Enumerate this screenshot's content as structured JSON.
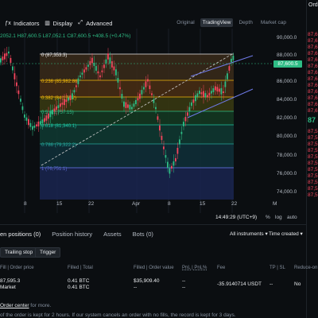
{
  "toolbar": {
    "indicators": "Indicators",
    "display": "Display",
    "advanced": "Advanced",
    "views": [
      "Original",
      "TradingView",
      "Depth",
      "Market cap"
    ]
  },
  "chart": {
    "ohlc_text": "2052.1 H87,600.5 L87,052.1 C87,600.5 +408.5 (+0.47%)",
    "y_labels": [
      "90,000.0",
      "88,000.0",
      "86,000.0",
      "84,000.0",
      "82,000.0",
      "80,000.0",
      "78,000.0",
      "76,000.0",
      "74,000.0"
    ],
    "last_price_tag": "87,600.5",
    "fib_levels": [
      {
        "label": "0 (87,353.3)",
        "color": "#f0f0f0"
      },
      {
        "label": "0.236 (85,982.86)",
        "color": "#f6465d"
      },
      {
        "label": "0.382 (84,174.2)",
        "color": "#f0b90b"
      },
      {
        "label": "0.5 (82,757.15)",
        "color": "#2ebd85"
      },
      {
        "label": "0.618 (81,340.1)",
        "color": "#1ec8a5"
      },
      {
        "label": "0.786 (79,322.2)",
        "color": "#26a69a"
      },
      {
        "label": "1 (76,751.1)",
        "color": "#5a6ad0"
      }
    ],
    "x_labels": [
      "8",
      "15",
      "22",
      "Apr",
      "8",
      "15",
      "22",
      "M"
    ],
    "time_readout": "14:49:29 (UTC+9)",
    "scale_options": [
      "%",
      "log",
      "auto"
    ],
    "colors": {
      "up": "#2ebd85",
      "down": "#f6465d",
      "accent": "#f0b90b"
    }
  },
  "orderbook": {
    "title": "Ord",
    "rows": [
      "87,6",
      "87,6",
      "87,6",
      "87,6",
      "87,6",
      "87,6",
      "87,6",
      "87,6",
      "87,6",
      "87,6",
      "87,6",
      "87,6",
      "87,6"
    ],
    "big_price": "87",
    "rows2": [
      "87,5",
      "87,5",
      "87,5",
      "87,5",
      "87,5",
      "87,5",
      "87,5",
      "87,5",
      "87,5",
      "87,5",
      "87,5"
    ]
  },
  "positions": {
    "tabs": [
      "en positions (0)",
      "Position history",
      "Assets",
      "Bots (0)"
    ],
    "filter_instruments": "All instruments",
    "filter_time": "Time created",
    "pills": [
      "Trailing stop",
      "Trigger"
    ],
    "headers": [
      "Fill | Order price",
      "Filled | Total",
      "Filled | Order value",
      "PnL | PnL%",
      "Fee",
      "TP | SL",
      "Reduce-on"
    ],
    "row": {
      "price": "87,595.3",
      "type": "Market",
      "filled": "0.41 BTC",
      "total": "0.41 BTC",
      "value": "$35,909.40",
      "value2": "--",
      "pnl": "--",
      "pnl2": "--",
      "fee": "-35.9140714 USDT",
      "tpsl": "--",
      "reduce": "No"
    },
    "footer_link": "Order center",
    "footer_link_suffix": " for more.",
    "footer_note": "of the order is kept for 2 hours. If our system cancels an order with no fills, the record is kept for 3 days."
  }
}
